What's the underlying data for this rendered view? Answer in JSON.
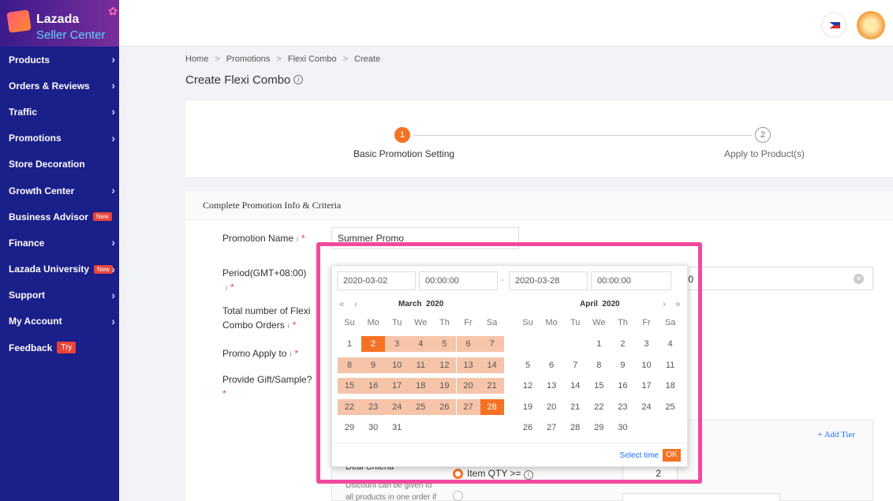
{
  "logo": {
    "line1": "Lazada",
    "line2": "Seller Center"
  },
  "sidebar": {
    "items": [
      {
        "label": "Products",
        "chevron": true
      },
      {
        "label": "Orders & Reviews",
        "chevron": true
      },
      {
        "label": "Traffic",
        "chevron": true
      },
      {
        "label": "Promotions",
        "chevron": true
      },
      {
        "label": "Store Decoration",
        "chevron": false
      },
      {
        "label": "Growth Center",
        "chevron": true
      },
      {
        "label": "Business Advisor",
        "chevron": false,
        "badge": "New"
      },
      {
        "label": "Finance",
        "chevron": true
      },
      {
        "label": "Lazada University",
        "chevron": true,
        "badge": "New"
      },
      {
        "label": "Support",
        "chevron": true
      },
      {
        "label": "My Account",
        "chevron": true
      },
      {
        "label": "Feedback",
        "chevron": false,
        "badge": "Try"
      }
    ]
  },
  "breadcrumb": [
    "Home",
    "Promotions",
    "Flexi Combo",
    "Create"
  ],
  "page_title": "Create Flexi Combo",
  "steps": [
    {
      "number": "1",
      "label": "Basic Promotion Setting",
      "active": true
    },
    {
      "number": "2",
      "label": "Apply to Product(s)",
      "active": false
    }
  ],
  "form": {
    "section_title": "Complete Promotion Info & Criteria",
    "promotion_name_label": "Promotion Name",
    "promotion_name_value": "Summer Promo",
    "period_label": "Period(GMT+08:00)",
    "period_tail": "0",
    "total_orders_label_1": "Total number of Flexi",
    "total_orders_label_2": "Combo Orders",
    "apply_to_label": "Promo Apply to",
    "gift_label": "Provide Gift/Sample?",
    "add_tier": "+ Add Tier",
    "deal_criteria": "Deal Criteria",
    "deal_desc": "Discount can be given to all products in one order if",
    "item_qty_label": "Item QTY >=",
    "item_qty_value": "2"
  },
  "datepicker": {
    "start_date": "2020-03-02",
    "start_time": "00:00:00",
    "dash": "-",
    "end_date": "2020-03-28",
    "end_time": "00:00:00",
    "weekdays": [
      "Su",
      "Mo",
      "Tu",
      "We",
      "Th",
      "Fr",
      "Sa"
    ],
    "months": [
      {
        "title": "March  2020",
        "first_weekday": 0,
        "days": 31,
        "selected_start": 2,
        "selected_end": 28
      },
      {
        "title": "April  2020",
        "first_weekday": 3,
        "days": 30
      }
    ],
    "select_time": "Select time",
    "ok": "OK"
  },
  "colors": {
    "accent": "#f57224",
    "range": "#f6c4a8",
    "sidebar": "#1a1f8a",
    "highlight": "#f04a9e"
  }
}
